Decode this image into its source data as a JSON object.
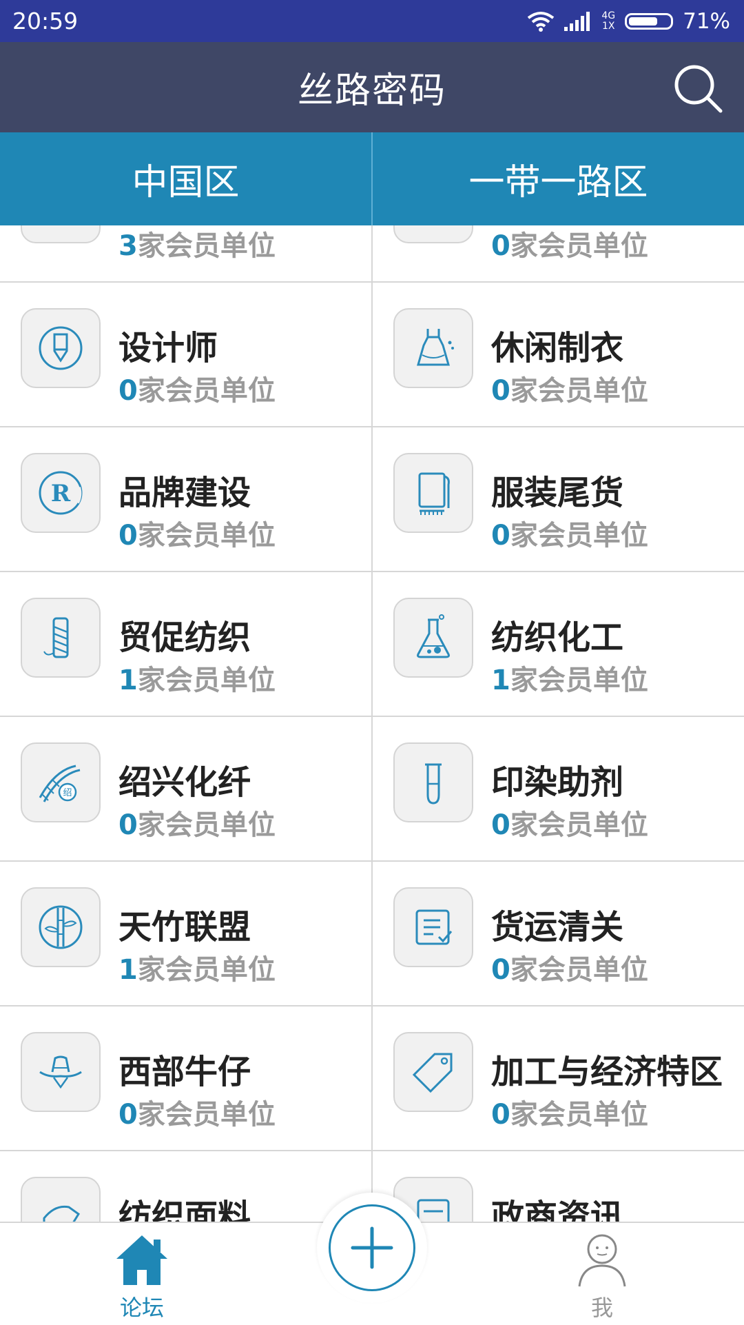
{
  "status_bar": {
    "time": "20:59",
    "network_top": "4G",
    "network_bottom": "1X",
    "battery_percent": "71%",
    "battery_level": 0.71
  },
  "header": {
    "title": "丝路密码"
  },
  "tabs": [
    {
      "label": "中国区",
      "active": true
    },
    {
      "label": "一带一路区",
      "active": false
    }
  ],
  "unit_suffix": "家会员单位",
  "categories": [
    {
      "title": "",
      "count": "3",
      "icon": "shirt-icon"
    },
    {
      "title": "",
      "count": "0",
      "icon": "jacket-icon"
    },
    {
      "title": "设计师",
      "count": "0",
      "icon": "pen-nib-icon"
    },
    {
      "title": "休闲制衣",
      "count": "0",
      "icon": "dress-icon"
    },
    {
      "title": "品牌建设",
      "count": "0",
      "icon": "registered-trademark-icon"
    },
    {
      "title": "服装尾货",
      "count": "0",
      "icon": "fabric-roll-icon"
    },
    {
      "title": "贸促纺织",
      "count": "1",
      "icon": "thread-spool-icon"
    },
    {
      "title": "纺织化工",
      "count": "1",
      "icon": "flask-icon"
    },
    {
      "title": "绍兴化纤",
      "count": "0",
      "icon": "fiber-rope-icon"
    },
    {
      "title": "印染助剂",
      "count": "0",
      "icon": "test-tube-icon"
    },
    {
      "title": "天竹联盟",
      "count": "1",
      "icon": "bamboo-icon"
    },
    {
      "title": "货运清关",
      "count": "0",
      "icon": "checklist-icon"
    },
    {
      "title": "西部牛仔",
      "count": "0",
      "icon": "cowboy-hat-icon"
    },
    {
      "title": "加工与经济特区",
      "count": "0",
      "icon": "price-tag-icon"
    },
    {
      "title": "纺织面料",
      "count": "",
      "icon": "fabric-icon"
    },
    {
      "title": "政商资讯",
      "count": "",
      "icon": "news-icon"
    }
  ],
  "bottom_nav": {
    "forum_label": "论坛",
    "me_label": "我"
  },
  "colors": {
    "status_bar": "#2e3a99",
    "title_bar": "#3f4766",
    "tab_bar": "#1f87b5",
    "accent": "#1f87b5"
  }
}
